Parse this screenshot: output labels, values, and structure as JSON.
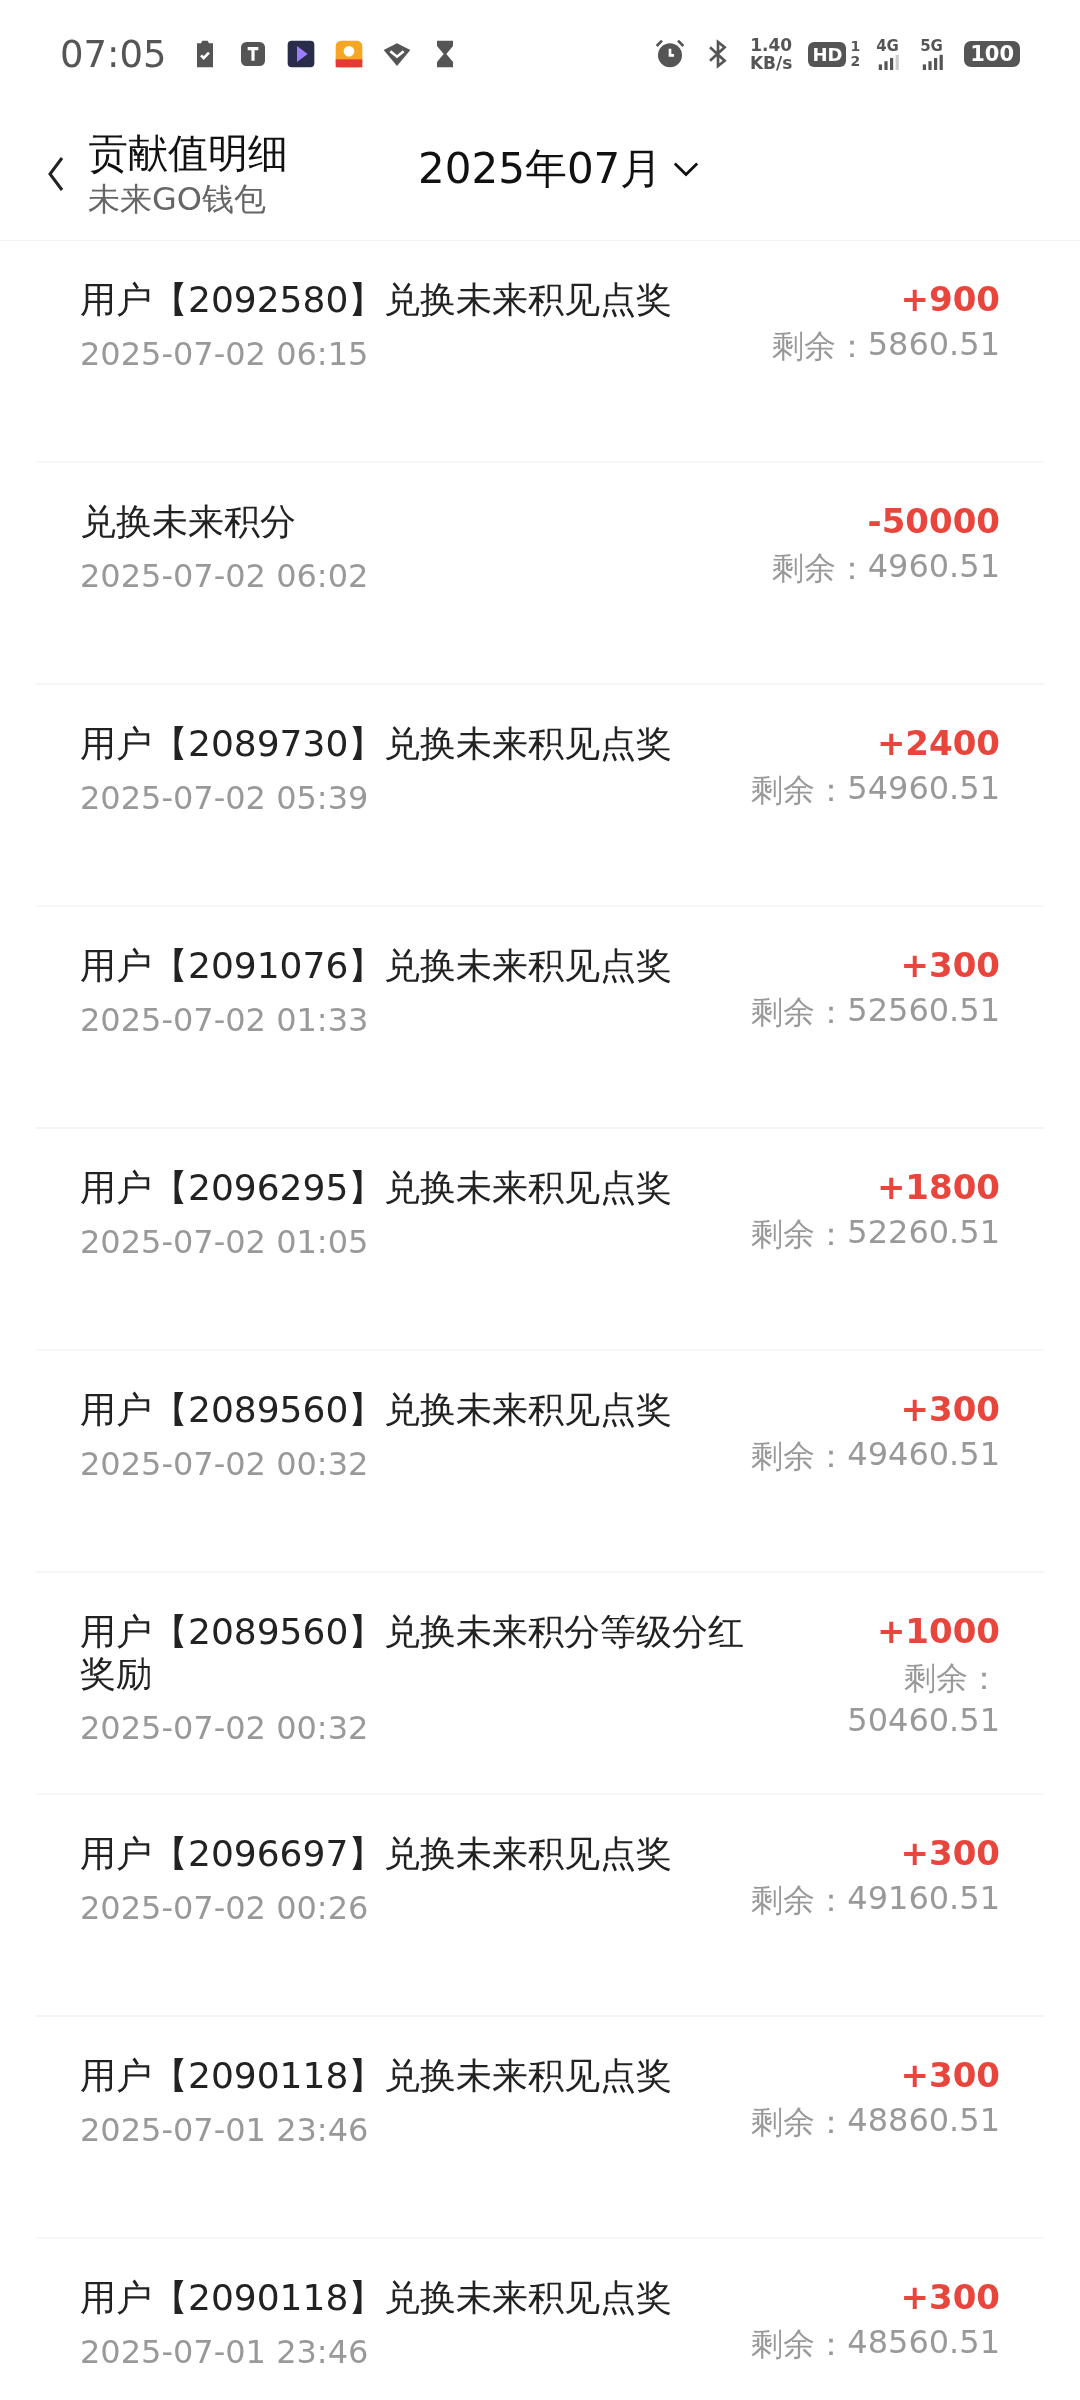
{
  "status_bar": {
    "time": "07:05",
    "net_speed": "1.40",
    "net_unit": "KB/s",
    "hd": "HD",
    "hd_sim": "1",
    "hd_sub": "2",
    "sim1": "4G",
    "sim2": "5G",
    "battery": "100"
  },
  "header": {
    "title": "贡献值明细",
    "subtitle": "未来GO钱包",
    "month": "2025年07月"
  },
  "records": [
    {
      "title": "用户【2092580】兑换未来积见点奖",
      "time": "2025-07-02 06:15",
      "amount": "+900",
      "balance_label": "剩余：",
      "balance": "5860.51"
    },
    {
      "title": "兑换未来积分",
      "time": "2025-07-02 06:02",
      "amount": "-50000",
      "balance_label": "剩余：",
      "balance": "4960.51"
    },
    {
      "title": "用户【2089730】兑换未来积见点奖",
      "time": "2025-07-02 05:39",
      "amount": "+2400",
      "balance_label": "剩余：",
      "balance": "54960.51"
    },
    {
      "title": "用户【2091076】兑换未来积见点奖",
      "time": "2025-07-02 01:33",
      "amount": "+300",
      "balance_label": "剩余：",
      "balance": "52560.51"
    },
    {
      "title": "用户【2096295】兑换未来积见点奖",
      "time": "2025-07-02 01:05",
      "amount": "+1800",
      "balance_label": "剩余：",
      "balance": "52260.51"
    },
    {
      "title": "用户【2089560】兑换未来积见点奖",
      "time": "2025-07-02 00:32",
      "amount": "+300",
      "balance_label": "剩余：",
      "balance": "49460.51"
    },
    {
      "title": "用户【2089560】兑换未来积分等级分红奖励",
      "time": "2025-07-02 00:32",
      "amount": "+1000",
      "balance_label": "剩余：",
      "balance": "50460.51"
    },
    {
      "title": "用户【2096697】兑换未来积见点奖",
      "time": "2025-07-02 00:26",
      "amount": "+300",
      "balance_label": "剩余：",
      "balance": "49160.51"
    },
    {
      "title": "用户【2090118】兑换未来积见点奖",
      "time": "2025-07-01 23:46",
      "amount": "+300",
      "balance_label": "剩余：",
      "balance": "48860.51"
    },
    {
      "title": "用户【2090118】兑换未来积见点奖",
      "time": "2025-07-01 23:46",
      "amount": "+300",
      "balance_label": "剩余：",
      "balance": "48560.51"
    }
  ]
}
